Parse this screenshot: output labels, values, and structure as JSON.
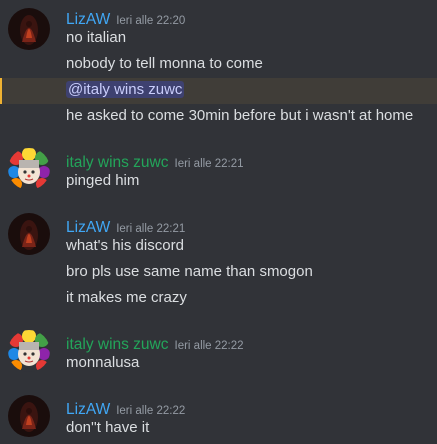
{
  "colors": {
    "background": "#313338",
    "liza_name": "#40a7f5",
    "italy_name": "#23a55a",
    "timestamp": "#949ba4",
    "text": "#dbdee1",
    "mention_bg": "#3e4170",
    "mention_text": "#c9cdfb",
    "mention_line_bg": "#403d38"
  },
  "messages": [
    {
      "author": "LizAW",
      "timestamp": "Ieri alle 22:20",
      "avatar_icon": "dark-figure-avatar",
      "lines": [
        "no italian",
        "nobody to tell monna to come",
        "@italy wins zuwc",
        "he asked to come 30min before but i wasn't at home"
      ]
    },
    {
      "author": "italy wins zuwc",
      "timestamp": "Ieri alle 22:21",
      "avatar_icon": "clown-girl-avatar",
      "lines": [
        "pinged him"
      ]
    },
    {
      "author": "LizAW",
      "timestamp": "Ieri alle 22:21",
      "avatar_icon": "dark-figure-avatar",
      "lines": [
        "what's his discord",
        "bro pls use same name than smogon",
        "it makes me crazy"
      ]
    },
    {
      "author": "italy wins zuwc",
      "timestamp": "Ieri alle 22:22",
      "avatar_icon": "clown-girl-avatar",
      "lines": [
        "monnalusa"
      ]
    },
    {
      "author": "LizAW",
      "timestamp": "Ieri alle 22:22",
      "avatar_icon": "dark-figure-avatar",
      "lines": [
        "don''t have it"
      ]
    }
  ]
}
